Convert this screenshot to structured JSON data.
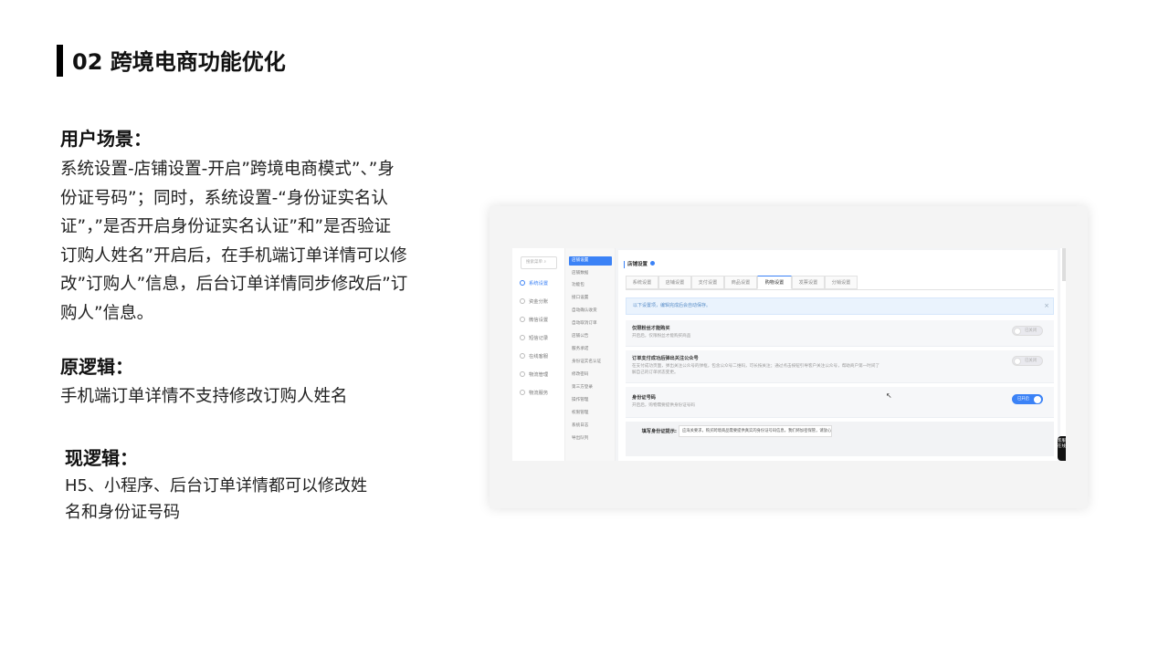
{
  "slide": {
    "title": "02 跨境电商功能优化"
  },
  "sections": {
    "scene": {
      "heading": "用户场景：",
      "lines": [
        "系统设置-店铺设置-开启”跨境电商模式”、”身",
        "份证号码”；同时，系统设置-“身份证实名认",
        "证”，”是否开启身份证实名认证”和”是否验证",
        "订购人姓名”开启后，在手机端订单详情可以修",
        "改”订购人”信息，后台订单详情同步修改后”订",
        "购人”信息。"
      ]
    },
    "old": {
      "heading": "原逻辑：",
      "lines": [
        "手机端订单详情不支持修改订购人姓名"
      ]
    },
    "new": {
      "heading": "现逻辑：",
      "lines": [
        "H5、小程序、后台订单详情都可以修改姓",
        "名和身份证号码"
      ]
    }
  },
  "screenshot": {
    "search_placeholder": "搜索菜单",
    "primary_nav": [
      {
        "label": "系统设置",
        "icon": "gear-icon",
        "active": true
      },
      {
        "label": "资金分账",
        "icon": "wallet-icon",
        "active": false
      },
      {
        "label": "微信设置",
        "icon": "wechat-icon",
        "active": false
      },
      {
        "label": "短信记录",
        "icon": "message-icon",
        "active": false
      },
      {
        "label": "在线客服",
        "icon": "headset-icon",
        "active": false
      },
      {
        "label": "物流管理",
        "icon": "truck-icon",
        "active": false
      },
      {
        "label": "物流服务",
        "icon": "box-icon",
        "active": false
      }
    ],
    "secondary_nav": [
      {
        "label": "店铺设置",
        "active": true
      },
      {
        "label": "店铺数据",
        "active": false
      },
      {
        "label": "功能包",
        "active": false
      },
      {
        "label": "接口设置",
        "active": false
      },
      {
        "label": "自动确认收货",
        "active": false
      },
      {
        "label": "自动取消订单",
        "active": false
      },
      {
        "label": "店铺公告",
        "active": false
      },
      {
        "label": "服务承诺",
        "active": false
      },
      {
        "label": "身份证实名认证",
        "active": false
      },
      {
        "label": "修改密码",
        "active": false
      },
      {
        "label": "第三方登录",
        "active": false
      },
      {
        "label": "操作管理",
        "active": false
      },
      {
        "label": "权限管理",
        "active": false
      },
      {
        "label": "系统日志",
        "active": false
      },
      {
        "label": "导出队列",
        "active": false
      }
    ],
    "page_title": "店铺设置",
    "tabs": [
      {
        "label": "系统设置",
        "active": false
      },
      {
        "label": "店铺设置",
        "active": false
      },
      {
        "label": "支付设置",
        "active": false
      },
      {
        "label": "商品设置",
        "active": false
      },
      {
        "label": "购物设置",
        "active": true
      },
      {
        "label": "发票设置",
        "active": false
      },
      {
        "label": "分销设置",
        "active": false
      }
    ],
    "notice": "以下设置项，编辑完成后会自动保存。",
    "notice_close": "×",
    "settings": [
      {
        "name": "仅限粉丝才能购买",
        "desc": [
          "开启后，仅限粉丝才能购买商品"
        ],
        "toggle_label": "已关闭",
        "on": false
      },
      {
        "name": "订单支付成功后弹出关注公众号",
        "desc": [
          "在支付成功页面，弹出关注公众号的弹框，包含公众号二维码，可长按关注；通过点击按钮引导客户关注公众号，帮助商户第一时间了",
          "解自己的订单状态变更。"
        ],
        "toggle_label": "已关闭",
        "on": false
      },
      {
        "name": "身份证号码",
        "desc": [
          "开启后，购物需要提供身份证号码"
        ],
        "toggle_label": "已开启",
        "on": true
      }
    ],
    "sub_setting": {
      "label": "填写身份证提示:",
      "value": "应海关要求，购买跨境商品需要提供真实的身份证号码信息，我们将加密保管，请放心填写。"
    },
    "side_tab": "客服在线"
  }
}
